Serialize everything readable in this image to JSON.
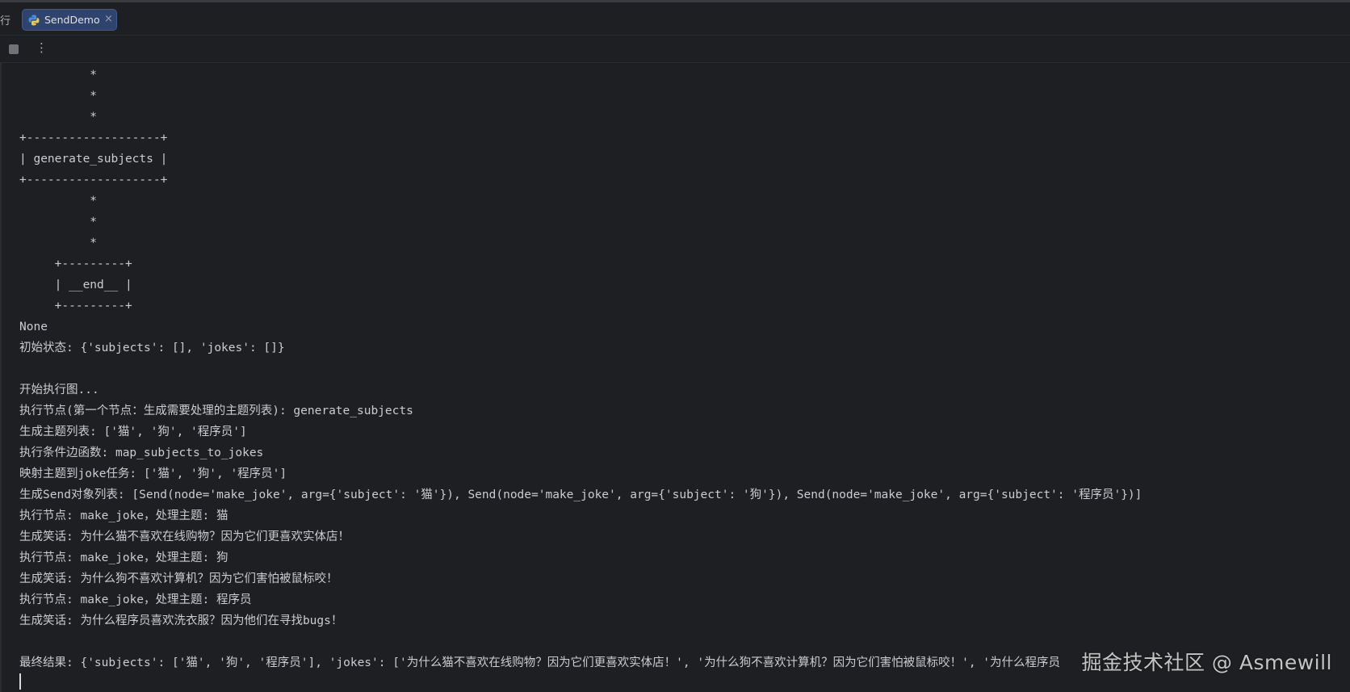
{
  "tab_bar": {
    "cut_tab_label": "行",
    "active_tab": {
      "icon": "python-icon",
      "label": "SendDemo",
      "close_glyph": "×"
    }
  },
  "toolbar": {
    "stop_icon": "stop-icon",
    "more_glyph": "⋮"
  },
  "console": {
    "lines": [
      "          *",
      "          *",
      "          *",
      "+-------------------+",
      "| generate_subjects |",
      "+-------------------+",
      "          *",
      "          *",
      "          *",
      "     +---------+",
      "     | __end__ |",
      "     +---------+",
      "None",
      "初始状态: {'subjects': [], 'jokes': []}",
      "",
      "开始执行图...",
      "执行节点(第一个节点：生成需要处理的主题列表): generate_subjects",
      "生成主题列表: ['猫', '狗', '程序员']",
      "执行条件边函数: map_subjects_to_jokes",
      "映射主题到joke任务: ['猫', '狗', '程序员']",
      "生成Send对象列表: [Send(node='make_joke', arg={'subject': '猫'}), Send(node='make_joke', arg={'subject': '狗'}), Send(node='make_joke', arg={'subject': '程序员'})]",
      "执行节点: make_joke，处理主题: 猫",
      "生成笑话: 为什么猫不喜欢在线购物？因为它们更喜欢实体店！",
      "执行节点: make_joke，处理主题: 狗",
      "生成笑话: 为什么狗不喜欢计算机？因为它们害怕被鼠标咬！",
      "执行节点: make_joke，处理主题: 程序员",
      "生成笑话: 为什么程序员喜欢洗衣服？因为他们在寻找bugs！",
      "",
      "最终结果: {'subjects': ['猫', '狗', '程序员'], 'jokes': ['为什么猫不喜欢在线购物？因为它们更喜欢实体店！', '为什么狗不喜欢计算机？因为它们害怕被鼠标咬！', '为什么程序员"
    ]
  },
  "watermark": "掘金技术社区 @ Asmewill",
  "colors": {
    "background": "#1e1f22",
    "console_text": "#c9ccd1",
    "tab_active_bg": "#2e436e"
  }
}
